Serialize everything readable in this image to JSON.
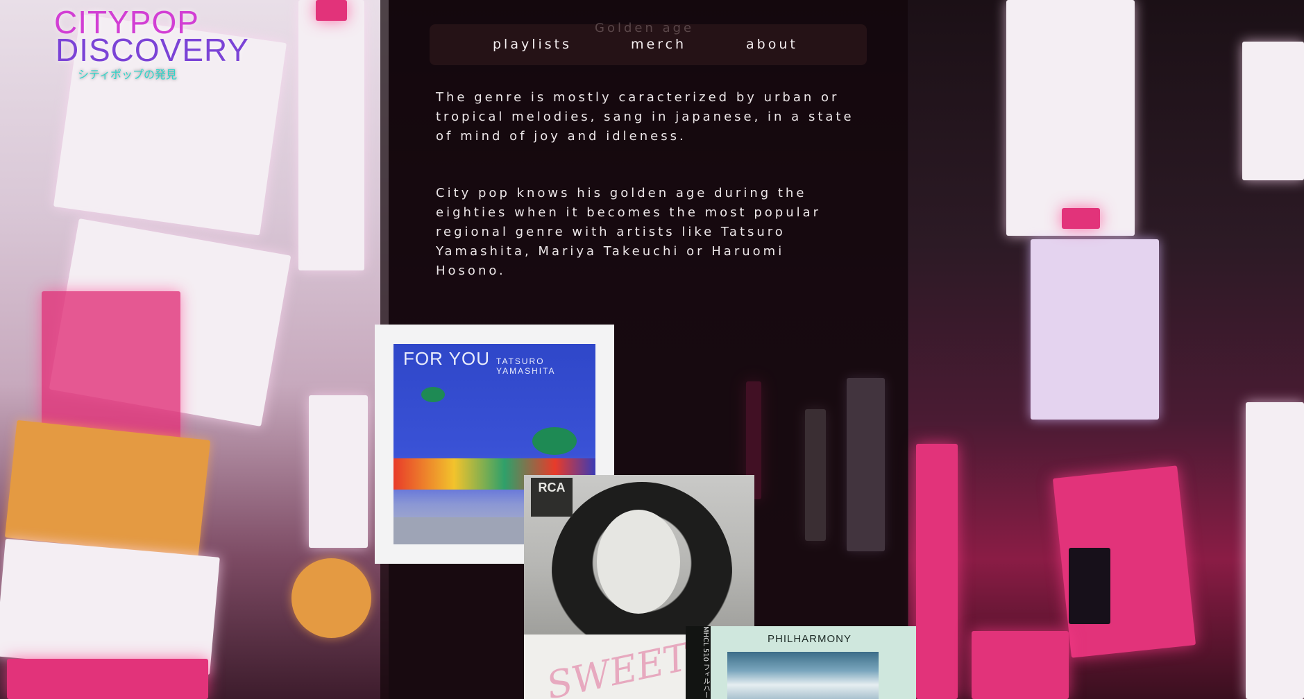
{
  "logo": {
    "line1": "CITYPOP",
    "line2": "DISCOVERY",
    "subtitle": "シティポップの発見"
  },
  "nav": {
    "ghost_label": "Golden age",
    "items": [
      {
        "label": "playlists"
      },
      {
        "label": "merch"
      },
      {
        "label": "about"
      }
    ]
  },
  "content": {
    "paragraph1": "The genre is mostly caracterized by urban or tropical melodies, sang in japanese, in a state of mind of joy and idleness.",
    "paragraph2": "City pop knows his golden age during the eighties when it becomes the most popular regional genre with artists like Tatsuro Yamashita, Mariya Takeuchi or Haruomi Hosono."
  },
  "albums": [
    {
      "title": "FOR YOU",
      "artist": "TATSURO YAMASHITA"
    },
    {
      "label": "RCA",
      "title": "SWEETEST"
    },
    {
      "title": "PHILHARMONY",
      "spine": "MHCL 510 フィルハー"
    }
  ],
  "colors": {
    "logo_pink": "#d23fd4",
    "logo_violet": "#7b43d6",
    "logo_teal": "#2fd5c9",
    "nav_text": "#f4eef0",
    "body_text": "#ece6e8"
  }
}
